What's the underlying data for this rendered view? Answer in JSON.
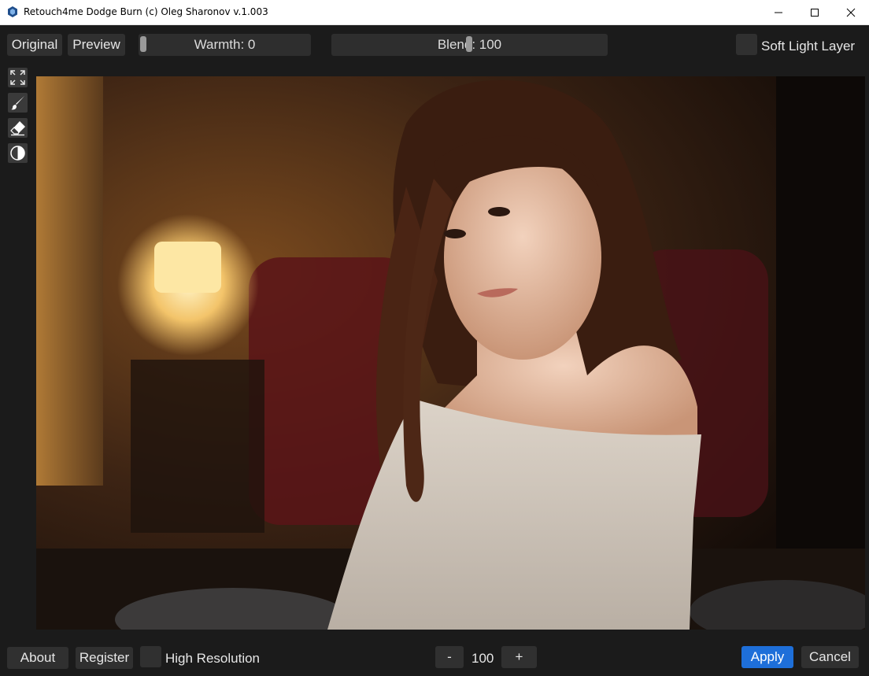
{
  "window": {
    "title": "Retouch4me Dodge Burn (c) Oleg Sharonov v.1.003",
    "icon": "hexagon-app-icon",
    "controls": [
      "minimize-icon",
      "maximize-icon",
      "close-icon"
    ]
  },
  "toolbar": {
    "original_label": "Original",
    "preview_label": "Preview",
    "warmth": {
      "label": "Warmth: 0",
      "value": 0
    },
    "blend": {
      "label": "Blend: 100",
      "value": 100
    },
    "soft_light_label": "Soft Light Layer",
    "soft_light_checked": false
  },
  "tools": [
    {
      "name": "fit-screen-icon"
    },
    {
      "name": "brush-icon"
    },
    {
      "name": "eraser-icon"
    },
    {
      "name": "contrast-icon"
    }
  ],
  "canvas": {
    "subject": "portrait photo of woman in beige off-shoulder sweater"
  },
  "bottom": {
    "about_label": "About",
    "register_label": "Register",
    "high_res_label": "High Resolution",
    "high_res_checked": false,
    "minus_label": "-",
    "zoom_value": "100",
    "plus_label": "+",
    "apply_label": "Apply",
    "cancel_label": "Cancel"
  },
  "colors": {
    "accent": "#1e6fd9",
    "background": "#1b1b1b",
    "button": "#303030"
  }
}
